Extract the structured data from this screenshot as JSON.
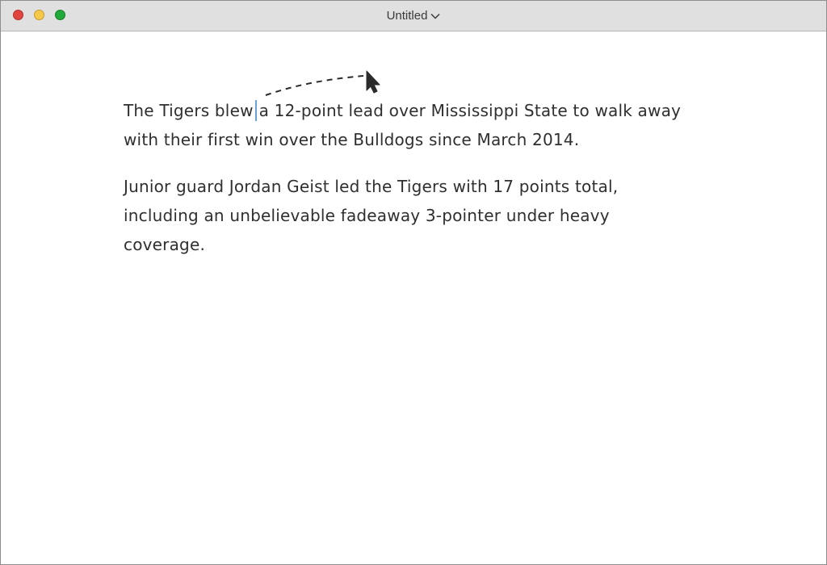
{
  "window": {
    "title": "Untitled"
  },
  "document": {
    "paragraph1_before_cursor": "The Tigers blew",
    "paragraph1_after_cursor": "a 12-point lead over Mississippi State to walk away with their first win over the Bulldogs since March 2014.",
    "paragraph2": "Junior guard Jordan Geist led the Tigers with 17 points total, including an unbelievable fadeaway 3-pointer under heavy coverage."
  },
  "colors": {
    "close": "#e0443e",
    "minimize": "#f5c94a",
    "zoom": "#21a83a",
    "caret": "#6aa2d8"
  },
  "icons": {
    "title_menu": "chevron-down-icon",
    "pointer": "mouse-pointer-icon"
  }
}
